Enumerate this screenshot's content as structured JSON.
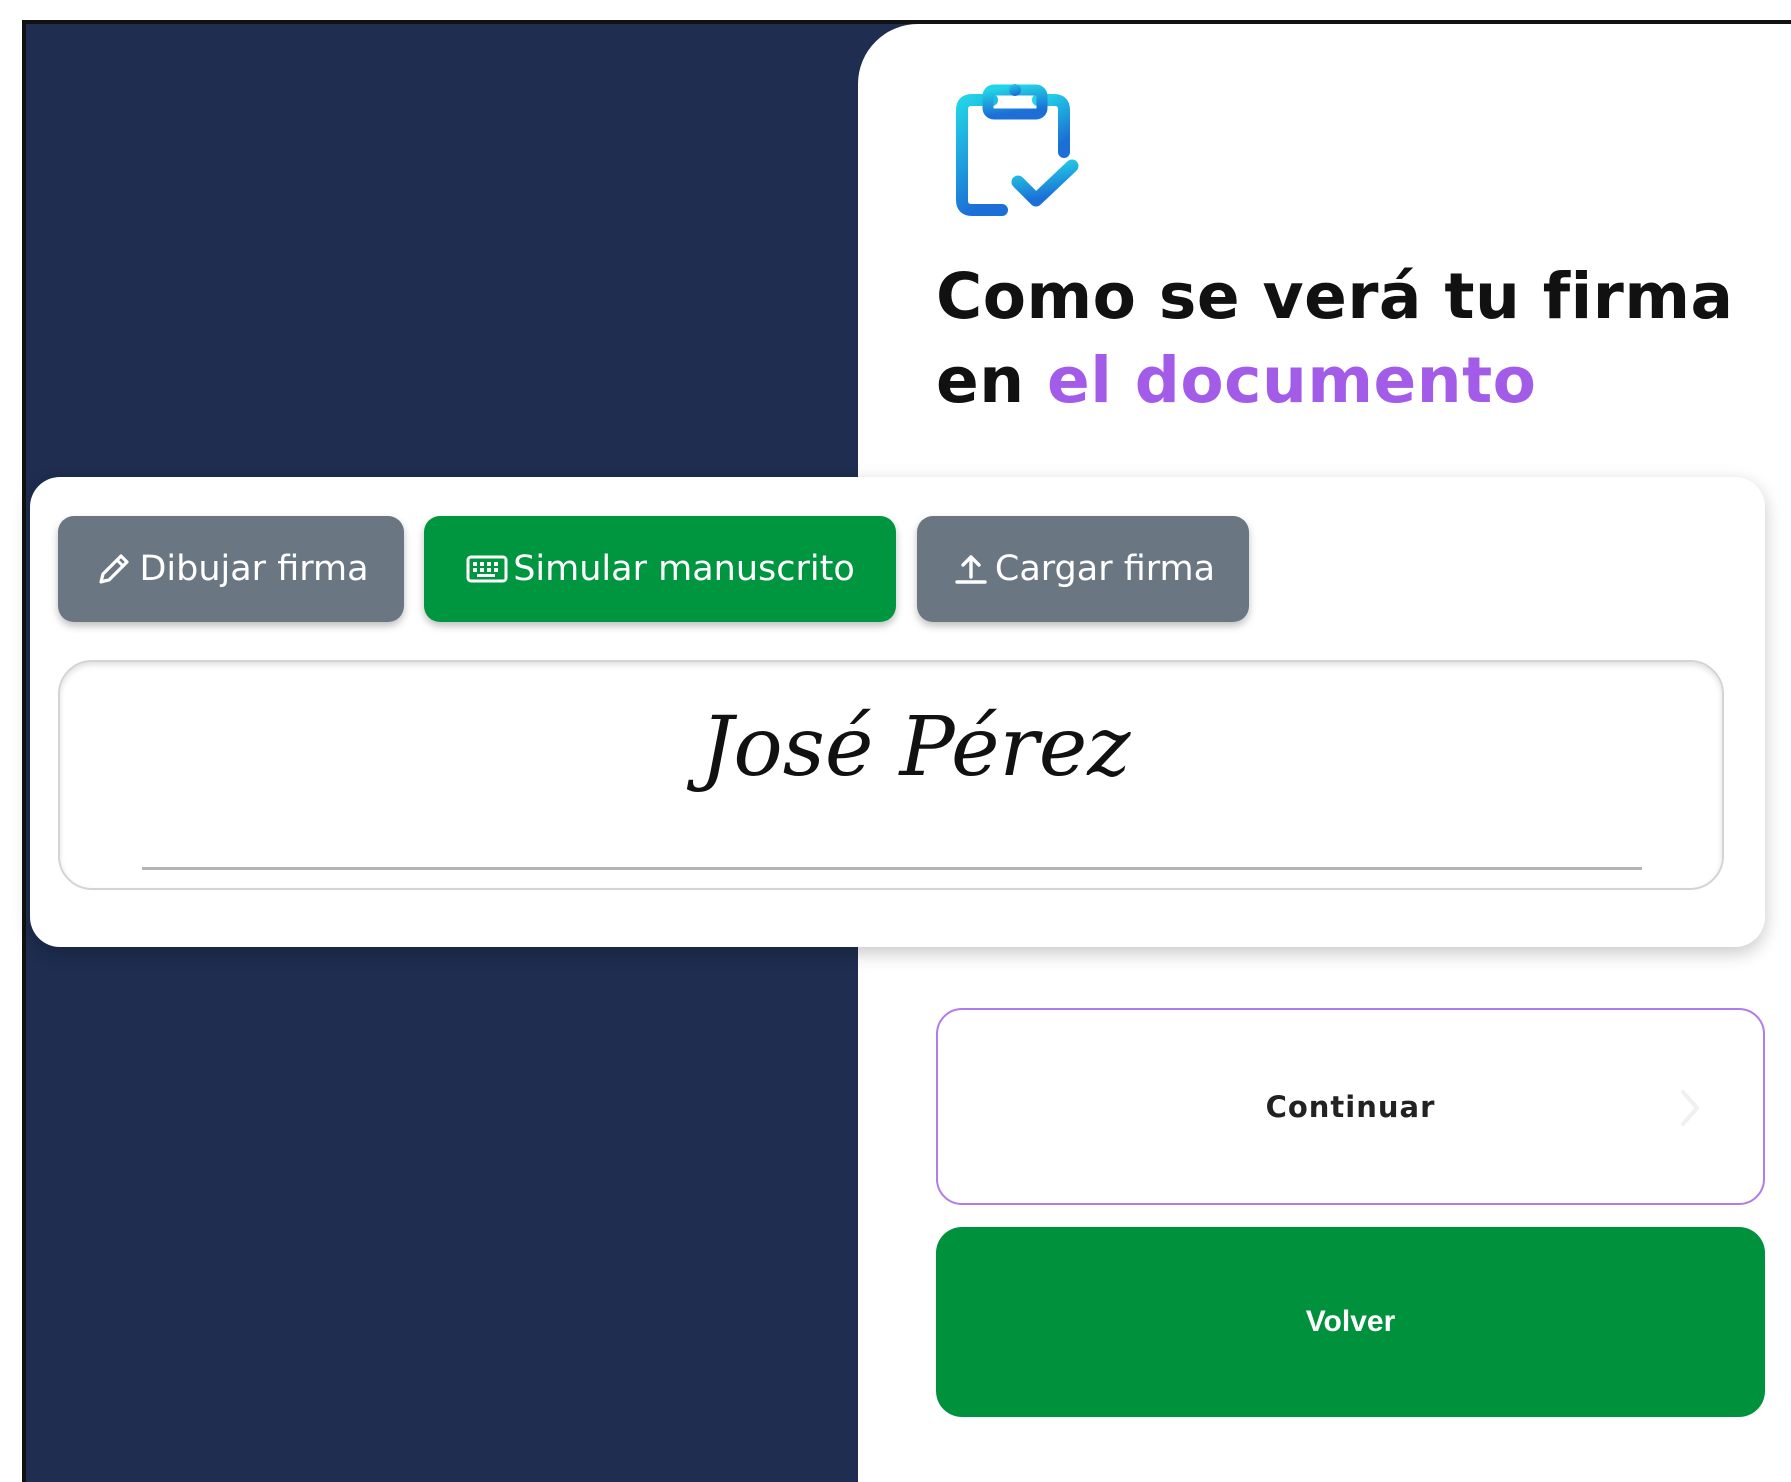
{
  "header": {
    "icon": "clipboard-check-icon",
    "title_line1": "Como se verá tu firma",
    "title_line2_prefix": "en ",
    "title_line2_accent": "el documento"
  },
  "tabs": [
    {
      "label": "Dibujar firma",
      "icon": "pencil-icon",
      "active": false
    },
    {
      "label": "Simular manuscrito",
      "icon": "keyboard-icon",
      "active": true
    },
    {
      "label": "Cargar firma",
      "icon": "upload-icon",
      "active": false
    }
  ],
  "signature": {
    "text": "José Pérez"
  },
  "actions": {
    "continue_label": "Continuar",
    "back_label": "Volver"
  },
  "colors": {
    "navy": "#1e2d50",
    "accent_purple": "#a35ce8",
    "active_green": "#00963f",
    "inactive_gray": "#6b7683",
    "icon_cyan": "#22c3e0",
    "icon_blue": "#1c6fd6"
  }
}
